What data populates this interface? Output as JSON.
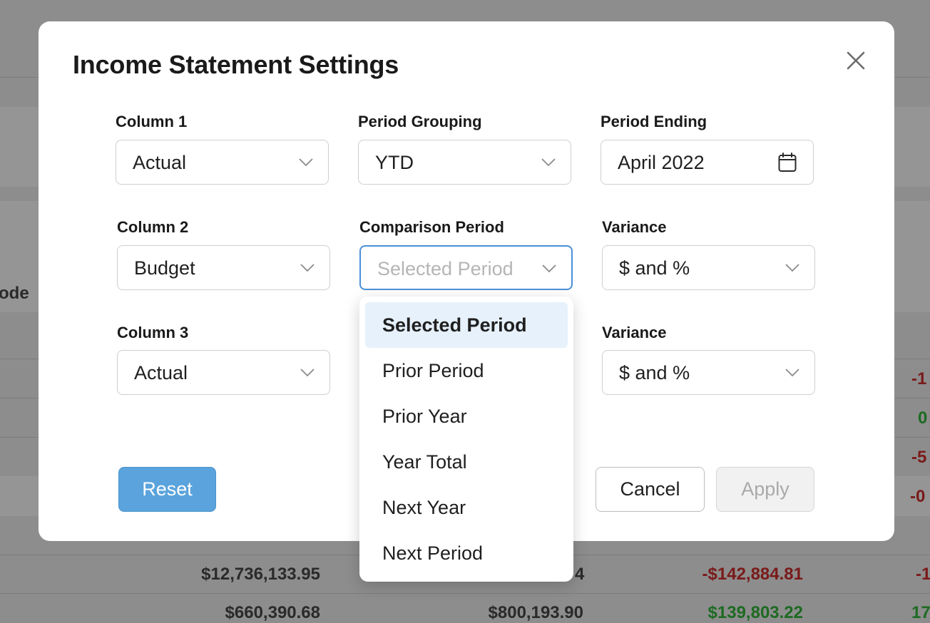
{
  "background": {
    "partial_label": "ode",
    "rows": [
      {
        "col1": "",
        "col2": "",
        "col3": "",
        "col4": "-1"
      },
      {
        "col1": "",
        "col2": "",
        "col3": "",
        "col4": "0"
      },
      {
        "col1": "",
        "col2": "",
        "col3": "",
        "col4": "-5"
      },
      {
        "col1": "",
        "col2": "",
        "col3": "",
        "col4": "-0"
      },
      {
        "col1": "$12,736,133.95",
        "col2": "4",
        "col3": "-$142,884.81",
        "col4": "-1"
      },
      {
        "col1": "$660,390.68",
        "col2": "$800,193.90",
        "col3": "$139,803.22",
        "col4": "17"
      }
    ]
  },
  "modal": {
    "title": "Income Statement Settings",
    "fields": {
      "column1": {
        "label": "Column 1",
        "value": "Actual"
      },
      "period_grouping": {
        "label": "Period Grouping",
        "value": "YTD"
      },
      "period_ending": {
        "label": "Period Ending",
        "value": "April 2022"
      },
      "column2": {
        "label": "Column 2",
        "value": "Budget"
      },
      "comparison_period": {
        "label": "Comparison Period",
        "placeholder": "Selected Period"
      },
      "variance1": {
        "label": "Variance",
        "value": "$ and %"
      },
      "column3": {
        "label": "Column 3",
        "value": "Actual"
      },
      "variance2": {
        "label": "Variance",
        "value": "$ and %"
      }
    },
    "buttons": {
      "reset": "Reset",
      "cancel": "Cancel",
      "apply": "Apply"
    }
  },
  "dropdown": {
    "options": [
      "Selected Period",
      "Prior Period",
      "Prior Year",
      "Year Total",
      "Next Year",
      "Next Period"
    ],
    "highlighted": "Selected Period"
  },
  "colors": {
    "accent": "#5aa3dc",
    "focus_border": "#4a90d9",
    "highlight_bg": "#e6f1fb",
    "negative": "#7a1a1a",
    "positive": "#1d6a22"
  }
}
